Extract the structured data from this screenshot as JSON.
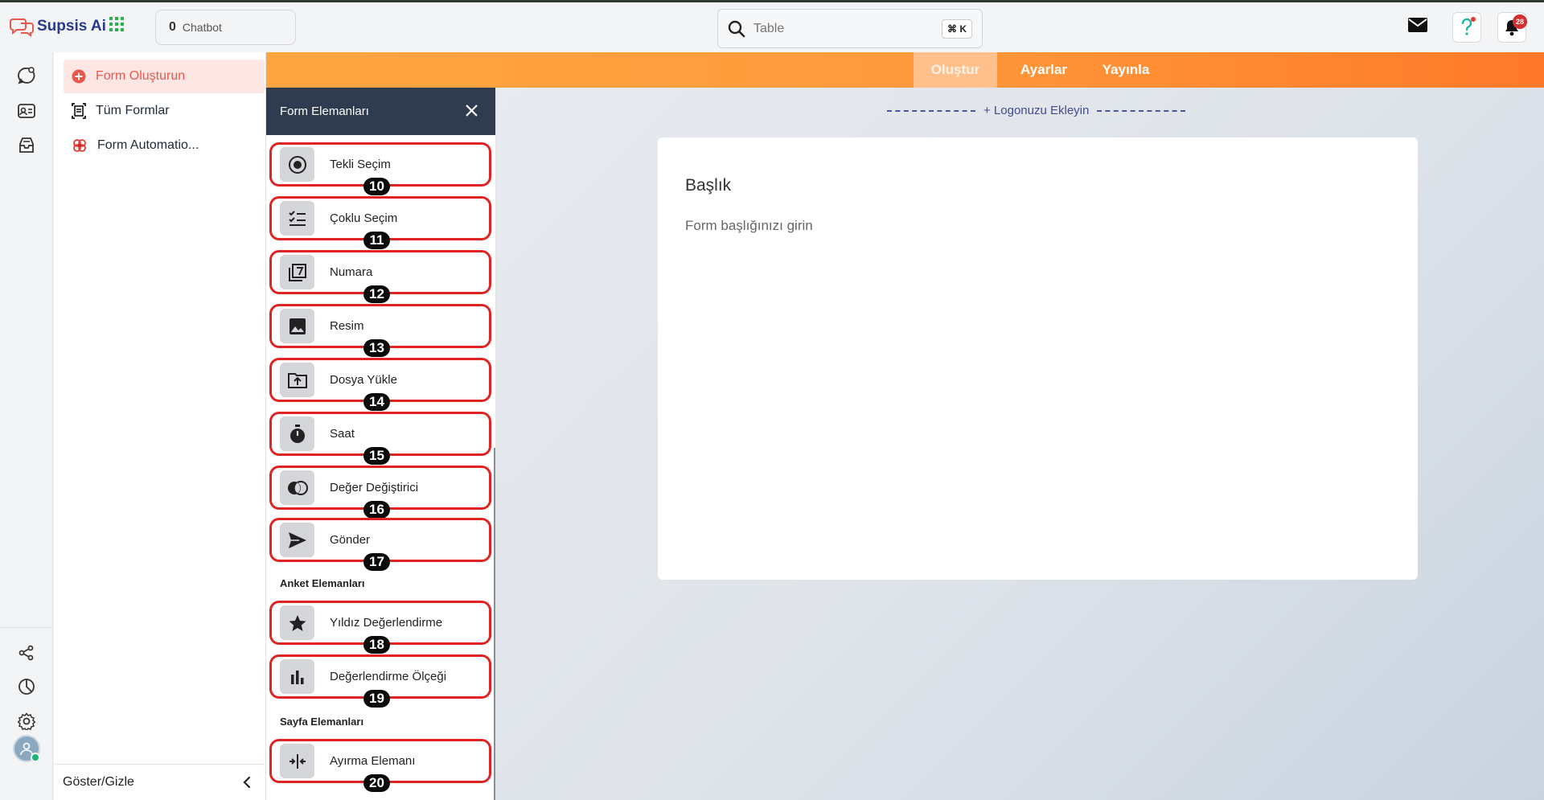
{
  "brand": {
    "name": "Supsis Ai"
  },
  "header": {
    "chatbot": {
      "count": "0",
      "label": "Chatbot"
    },
    "search": {
      "placeholder": "Table",
      "shortcut": "⌘ K"
    },
    "notifications_count": "28"
  },
  "sidebar": {
    "items": [
      {
        "label": "Form Oluşturun",
        "icon": "plus-circle-icon"
      },
      {
        "label": "Tüm Formlar",
        "icon": "form-list-icon"
      },
      {
        "label": "Form Automatio...",
        "icon": "automation-icon"
      }
    ],
    "footer_label": "Göster/Gizle"
  },
  "tabs": [
    {
      "label": "Oluştur",
      "active": true
    },
    {
      "label": "Ayarlar",
      "active": false
    },
    {
      "label": "Yayınla",
      "active": false
    }
  ],
  "panel": {
    "title": "Form Elemanları",
    "form_elements": [
      {
        "label": "Tekli Seçim",
        "number": "10",
        "icon": "radio-icon"
      },
      {
        "label": "Çoklu Seçim",
        "number": "11",
        "icon": "checklist-icon"
      },
      {
        "label": "Numara",
        "number": "12",
        "icon": "number-icon"
      },
      {
        "label": "Resim",
        "number": "13",
        "icon": "image-icon"
      },
      {
        "label": "Dosya Yükle",
        "number": "14",
        "icon": "upload-icon"
      },
      {
        "label": "Saat",
        "number": "15",
        "icon": "timer-icon"
      },
      {
        "label": "Değer Değiştirici",
        "number": "16",
        "icon": "toggle-icon"
      },
      {
        "label": "Gönder",
        "number": "17",
        "icon": "send-icon"
      }
    ],
    "survey_title": "Anket Elemanları",
    "survey_elements": [
      {
        "label": "Yıldız Değerlendirme",
        "number": "18",
        "icon": "star-icon"
      },
      {
        "label": "Değerlendirme Ölçeği",
        "number": "19",
        "icon": "bar-chart-icon"
      }
    ],
    "page_title": "Sayfa Elemanları",
    "page_elements": [
      {
        "label": "Ayırma Elemanı",
        "number": "20",
        "icon": "divider-icon"
      }
    ]
  },
  "canvas": {
    "add_logo": "+ Logonuzu Ekleyin",
    "form_title": "Başlık",
    "form_subtitle": "Form başlığınızı girin"
  },
  "colors": {
    "accent": "#e9584b",
    "orange_bar": "#ff9a3c",
    "panel_header": "#2f3b4f",
    "highlight_border": "#e02424"
  }
}
